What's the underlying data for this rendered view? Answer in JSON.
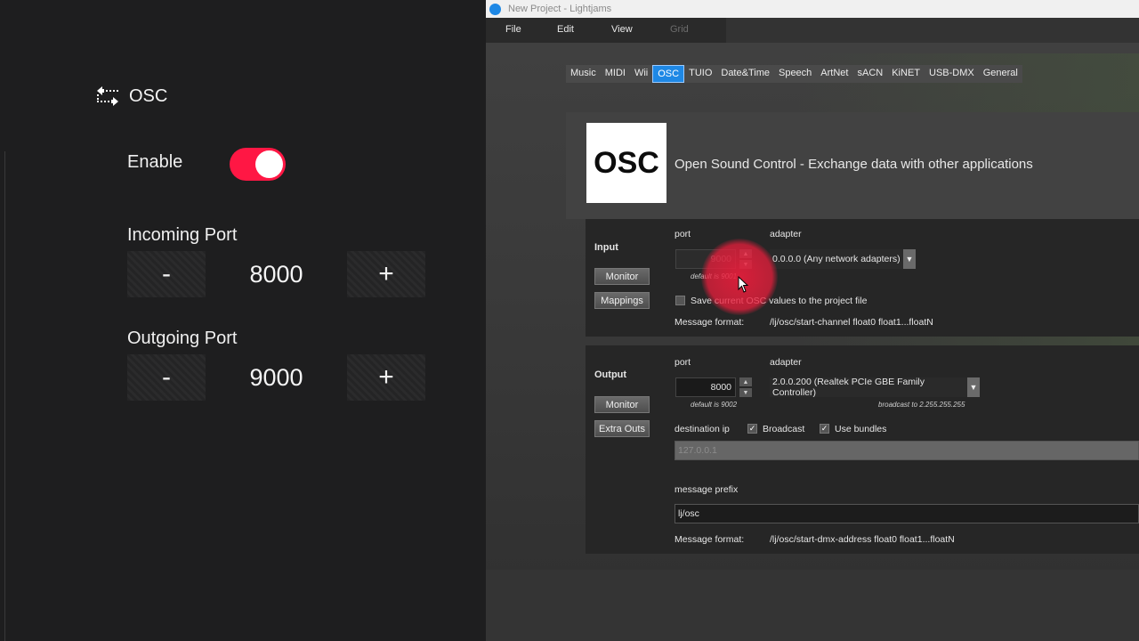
{
  "left_panel": {
    "title": "OSC",
    "enable_label": "Enable",
    "enable_on": true,
    "incoming_port": {
      "label": "Incoming Port",
      "minus": "-",
      "plus": "+",
      "value": "8000"
    },
    "outgoing_port": {
      "label": "Outgoing Port",
      "minus": "-",
      "plus": "+",
      "value": "9000"
    },
    "accent_color": "#ff1744"
  },
  "window": {
    "title": "New Project - Lightjams",
    "menu": [
      "File",
      "Edit",
      "View",
      "Grid"
    ],
    "tabs": [
      "Music",
      "MIDI",
      "Wii",
      "OSC",
      "TUIO",
      "Date&Time",
      "Speech",
      "ArtNet",
      "sACN",
      "KiNET",
      "USB-DMX",
      "General"
    ],
    "active_tab": "OSC",
    "logo_text": "OSC",
    "description": "Open Sound Control - Exchange data with other applications"
  },
  "input": {
    "heading": "Input",
    "port_label": "port",
    "adapter_label": "adapter",
    "port_value": "9000",
    "port_default": "default is 9001",
    "adapter_value": "0.0.0.0 (Any network adapters)",
    "monitor": "Monitor",
    "mappings": "Mappings",
    "save_label": "Save current OSC values to the project file",
    "msg_format_label": "Message format:",
    "msg_format_value": "/lj/osc/start-channel float0 float1...floatN"
  },
  "output": {
    "heading": "Output",
    "port_label": "port",
    "adapter_label": "adapter",
    "port_value": "8000",
    "port_default": "default is 9002",
    "adapter_value": "2.0.0.200 (Realtek PCIe GBE Family Controller)",
    "broadcast_hint": "broadcast to 2.255.255.255",
    "monitor": "Monitor",
    "extra_outs": "Extra Outs",
    "destination_ip_label": "destination ip",
    "broadcast_label": "Broadcast",
    "use_bundles_label": "Use bundles",
    "destination_ip_value": "127.0.0.1",
    "message_prefix_label": "message prefix",
    "message_prefix_value": "lj/osc",
    "msg_format_label": "Message format:",
    "msg_format_value": "/lj/osc/start-dmx-address float0 float1...floatN"
  }
}
